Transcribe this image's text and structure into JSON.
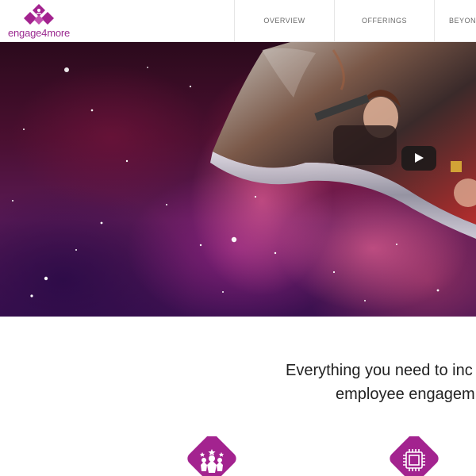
{
  "header": {
    "logo_text": "engage4more",
    "nav": [
      {
        "label": "OVERVIEW"
      },
      {
        "label": "OFFERINGS"
      },
      {
        "label": "BEYOND"
      }
    ]
  },
  "hero": {
    "play_icon": "play-icon"
  },
  "main": {
    "headline_line1": "Everything you need to inc",
    "headline_line2": "employee engagem",
    "features": [
      {
        "icon": "team-star-icon"
      },
      {
        "icon": "chip-icon"
      }
    ]
  },
  "colors": {
    "brand": "#a3238f",
    "nav_text": "#6a6a6a",
    "headline_text": "#222222"
  }
}
